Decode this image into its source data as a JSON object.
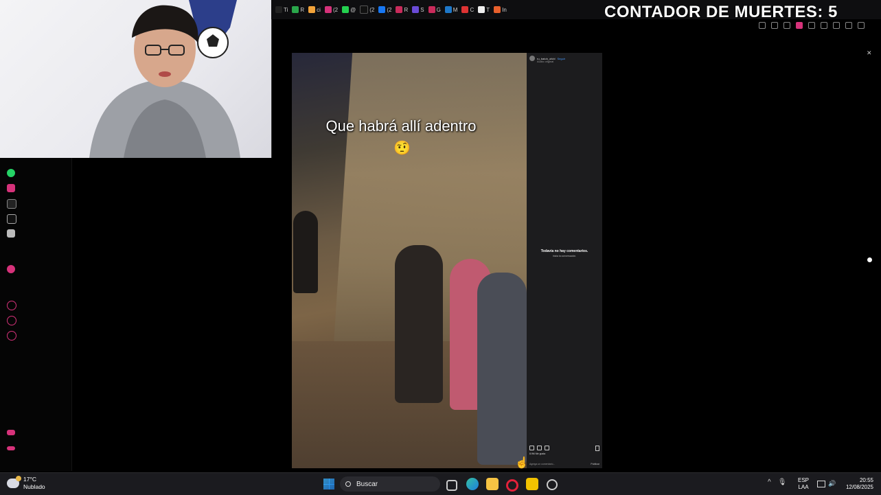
{
  "overlay": {
    "death_counter": "CONTADOR DE MUERTES: 5"
  },
  "tabs": [
    {
      "label": "Ti",
      "color": "#222"
    },
    {
      "label": "R",
      "color": "#2aa64b"
    },
    {
      "label": "ci",
      "color": "#f2a33a"
    },
    {
      "label": "(2",
      "color": "#d6327a"
    },
    {
      "label": "@",
      "color": "#24d04f"
    },
    {
      "label": "(2",
      "color": "#111"
    },
    {
      "label": "(2",
      "color": "#1877f2"
    },
    {
      "label": "R",
      "color": "#c92b5b"
    },
    {
      "label": "S",
      "color": "#6a4bd6"
    },
    {
      "label": "G",
      "color": "#c92b5b"
    },
    {
      "label": "M",
      "color": "#1e78c9"
    },
    {
      "label": "C",
      "color": "#d33"
    },
    {
      "label": "T",
      "color": "#eee"
    },
    {
      "label": "In",
      "color": "#e8602c"
    }
  ],
  "video": {
    "caption": "Que habrá allí adentro",
    "emoji": "🤨"
  },
  "comments_panel": {
    "username": "ru_batoh_ofcbl",
    "follow": "Seguir",
    "subtitle": "Audio original",
    "empty_title": "Todavía no hay comentarios.",
    "empty_subtitle": "Inicia la conversación.",
    "likes": "8.9M Me gusta",
    "compose_placeholder": "Agrega un comentario...",
    "publish": "Publicar"
  },
  "taskbar": {
    "temperature": "17°C",
    "condition": "Nublado",
    "search_label": "Buscar",
    "lang_top": "ESP",
    "lang_bottom": "LAA",
    "time": "20:55",
    "date": "12/08/2025"
  },
  "colors": {
    "accent_pink": "#d6327a",
    "whatsapp": "#25d366",
    "taskbar": "#1b1b1f"
  }
}
